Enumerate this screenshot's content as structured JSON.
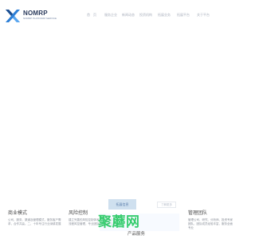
{
  "brand": {
    "name": "NOMRP",
    "tagline": "NOMRP PLATFORM SERVICE",
    "accent": "#2d7fd6"
  },
  "nav": {
    "items": [
      {
        "label": "首　页"
      },
      {
        "label": "服务企业"
      },
      {
        "label": "新闻动态"
      },
      {
        "label": "投资机构"
      },
      {
        "label": "拓展业务"
      },
      {
        "label": "拓展平台"
      },
      {
        "label": "关于平台"
      }
    ]
  },
  "hero": {
    "primary_button": "拓展信息",
    "secondary_button": "了解更多"
  },
  "columns": [
    {
      "title": "商业模式",
      "text": "公司、服务、渠道及管理模式，服务客户需求，合作共赢。二、十年专注行业深耕发展"
    },
    {
      "title": "风险控制",
      "text": "建立完善的风险控制体系，保障资金安全，全流程风控管理，专业团队保障运营稳健"
    },
    {
      "title": "管理团队",
      "text": "管理公司、研究、分析师、投资专家团队，团队成员经验丰富，服务全面专业"
    }
  ],
  "section": {
    "title": "产品服务"
  },
  "watermark": {
    "text": "聚蘑网"
  }
}
